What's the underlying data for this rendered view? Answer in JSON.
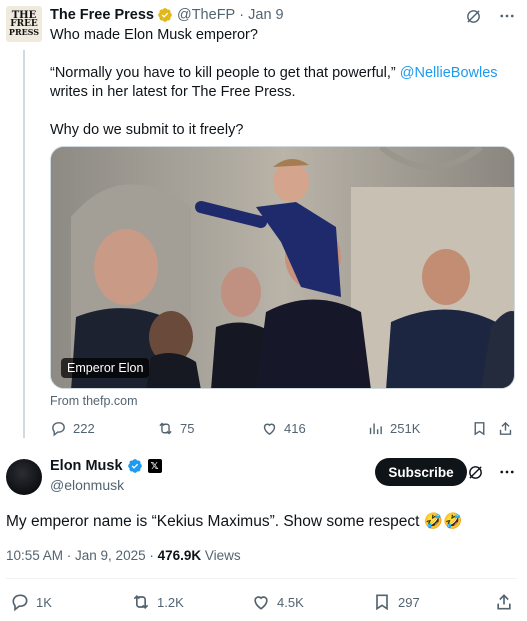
{
  "parent_tweet": {
    "author_name": "The Free Press",
    "handle": "@TheFP",
    "dot": "·",
    "date": "Jan 9",
    "avatar_lines": [
      "THE",
      "FREE",
      "PRESS"
    ],
    "text_line1": "Who made Elon Musk emperor?",
    "text_quote": "“Normally you have to kill people to get that powerful,”",
    "mention": "@NellieBowles",
    "text_quote_tail": "writes in her latest for The Free Press.",
    "text_question": "Why do we submit to it freely?",
    "media_caption": "Emperor Elon",
    "link_source": "From thefp.com",
    "stats": {
      "replies": "222",
      "reposts": "75",
      "likes": "416",
      "views": "251K"
    }
  },
  "main_tweet": {
    "author_name": "Elon Musk",
    "handle": "@elonmusk",
    "subscribe_label": "Subscribe",
    "text": "My emperor name is “Kekius Maximus”. Show some respect 🤣🤣",
    "timestamp": "10:55 AM · Jan 9, 2025 · ",
    "views_count": "476.9K",
    "views_label": " Views",
    "stats": {
      "replies": "1K",
      "reposts": "1.2K",
      "likes": "4.5K",
      "bookmarks": "297"
    }
  },
  "colors": {
    "accent": "#1d9bf0",
    "muted": "#536471",
    "gold": "#e2b719",
    "text": "#0f1419"
  },
  "icons": [
    "grok-icon",
    "more-icon",
    "reply-icon",
    "repost-icon",
    "like-icon",
    "views-icon",
    "bookmark-icon",
    "share-icon",
    "verified-gold-icon",
    "verified-blue-icon",
    "x-affiliate-icon"
  ]
}
